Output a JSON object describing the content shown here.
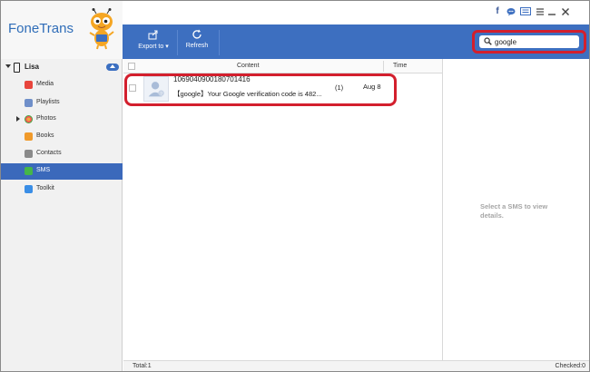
{
  "app": {
    "name": "FoneTrans"
  },
  "titlebar": {
    "icons": [
      "facebook-icon",
      "chat-icon",
      "feedback-icon",
      "menu-icon",
      "minimize-icon",
      "close-icon"
    ]
  },
  "sidebar": {
    "device": "Lisa",
    "items": [
      {
        "label": "Media",
        "icon": "media-icon",
        "color": "#e8453c"
      },
      {
        "label": "Playlists",
        "icon": "playlists-icon",
        "color": "#6f8fc9"
      },
      {
        "label": "Photos",
        "icon": "photos-icon",
        "color": "#f2a93b"
      },
      {
        "label": "Books",
        "icon": "books-icon",
        "color": "#f09a2b"
      },
      {
        "label": "Contacts",
        "icon": "contacts-icon",
        "color": "#7a7a7a"
      },
      {
        "label": "SMS",
        "icon": "sms-icon",
        "color": "#45b649"
      },
      {
        "label": "Toolkit",
        "icon": "toolkit-icon",
        "color": "#3a8ee6"
      }
    ],
    "active": "SMS"
  },
  "toolbar": {
    "export_label": "Export to",
    "refresh_label": "Refresh"
  },
  "search": {
    "value": "google"
  },
  "list": {
    "columns": {
      "content": "Content",
      "time": "Time"
    },
    "rows": [
      {
        "number": "1069040900180701416",
        "preview": "【google】Your Google verification code is 482...",
        "count": "(1)",
        "time": "Aug 8"
      }
    ]
  },
  "detail": {
    "placeholder": "Select a SMS to view details."
  },
  "status": {
    "total": "Total:1",
    "checked": "Checked:0"
  },
  "colors": {
    "accent": "#3d6fc0",
    "highlight": "#d31f2d",
    "active_nav": "#3b69bb"
  }
}
